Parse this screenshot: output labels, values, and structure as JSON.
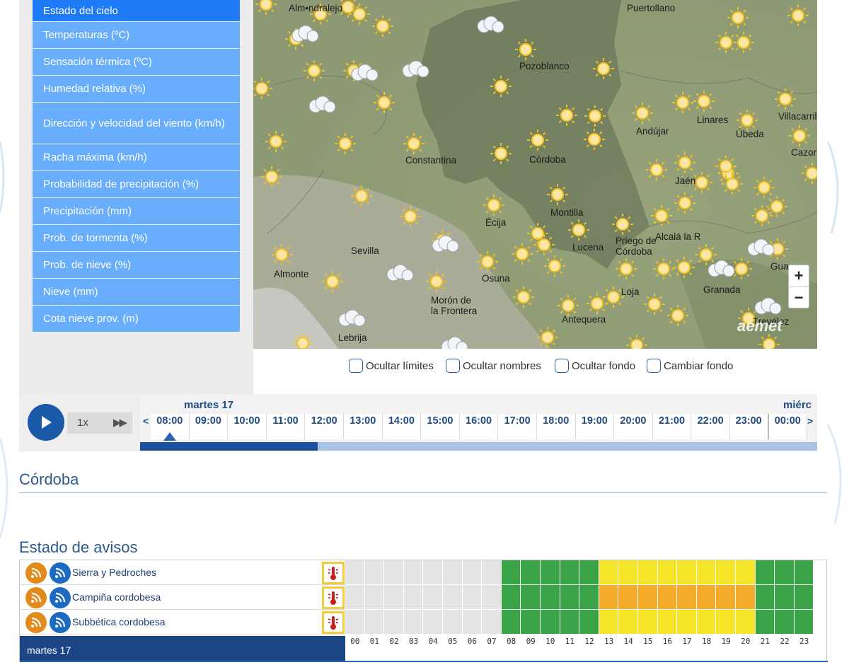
{
  "menu": {
    "items": [
      {
        "label": "Estado del cielo",
        "active": true
      },
      {
        "label": "Temperaturas (ºC)"
      },
      {
        "label": "Sensación térmica (ºC)"
      },
      {
        "label": "Humedad relativa (%)"
      },
      {
        "label": "Dirección y velocidad del viento (km/h)"
      },
      {
        "label": "Racha máxima (km/h)"
      },
      {
        "label": "Probabilidad de precipitación (%)"
      },
      {
        "label": "Precipitación (mm)"
      },
      {
        "label": "Prob. de tormenta (%)"
      },
      {
        "label": "Prob. de nieve (%)"
      },
      {
        "label": "Nieve (mm)"
      },
      {
        "label": "Cota nieve prov. (m)"
      }
    ]
  },
  "map": {
    "places": [
      "Alm•ndralejo",
      "Puertollano",
      "Pozoblanco",
      "Villacarril",
      "Linares",
      "Andújar",
      "Úbeda",
      "Cazor",
      "Constantina",
      "Córdoba",
      "Jaén",
      "Écija",
      "Montilla",
      "Sevilla",
      "Priego de Córdoba",
      "Alcalá la R",
      "Lucena",
      "Almonte",
      "Osuna",
      "Gua",
      "Loja",
      "Granada",
      "Morón de la Frontera",
      "Antequera",
      "Trevélez",
      "Lebrija"
    ],
    "zoom_in": "+",
    "zoom_out": "−",
    "watermark": "aemet"
  },
  "map_options": {
    "hide_limits": "Ocultar límites",
    "hide_names": "Ocultar nombres",
    "hide_background": "Ocultar fondo",
    "change_background": "Cambiar fondo"
  },
  "timeline": {
    "speed": "1x",
    "day": "martes 17",
    "next_day": "miérc",
    "hours": [
      "08:00",
      "09:00",
      "10:00",
      "11:00",
      "12:00",
      "13:00",
      "14:00",
      "15:00",
      "16:00",
      "17:00",
      "18:00",
      "19:00",
      "20:00",
      "21:00",
      "22:00",
      "23:00",
      "00:00"
    ],
    "selected_hour": "08:00",
    "progress": 0.262
  },
  "location": {
    "title": "Córdoba"
  },
  "warnings": {
    "title": "Estado de avisos",
    "day_label": "martes 17",
    "hours": [
      "00",
      "01",
      "02",
      "03",
      "04",
      "05",
      "06",
      "07",
      "08",
      "09",
      "10",
      "11",
      "12",
      "13",
      "14",
      "15",
      "16",
      "17",
      "18",
      "19",
      "20",
      "21",
      "22",
      "23"
    ],
    "colors": {
      "none": "#e4e4e4",
      "green": "#3aa348",
      "yellow": "#f5e62c",
      "orange": "#f5ac2c",
      "rss_orange": "#e38a1c",
      "rss_blue": "#1c6ac2"
    },
    "zones": [
      {
        "name": "Sierra y Pedroches",
        "levels": [
          "none",
          "none",
          "none",
          "none",
          "none",
          "none",
          "none",
          "none",
          "green",
          "green",
          "green",
          "green",
          "green",
          "yellow",
          "yellow",
          "yellow",
          "yellow",
          "yellow",
          "yellow",
          "yellow",
          "yellow",
          "green",
          "green",
          "green"
        ]
      },
      {
        "name": "Campiña cordobesa",
        "levels": [
          "none",
          "none",
          "none",
          "none",
          "none",
          "none",
          "none",
          "none",
          "green",
          "green",
          "green",
          "green",
          "green",
          "orange",
          "orange",
          "orange",
          "orange",
          "orange",
          "orange",
          "orange",
          "orange",
          "green",
          "green",
          "green"
        ]
      },
      {
        "name": "Subbética cordobesa",
        "levels": [
          "none",
          "none",
          "none",
          "none",
          "none",
          "none",
          "none",
          "none",
          "green",
          "green",
          "green",
          "green",
          "green",
          "yellow",
          "yellow",
          "yellow",
          "yellow",
          "yellow",
          "yellow",
          "yellow",
          "yellow",
          "green",
          "green",
          "green"
        ]
      }
    ]
  }
}
